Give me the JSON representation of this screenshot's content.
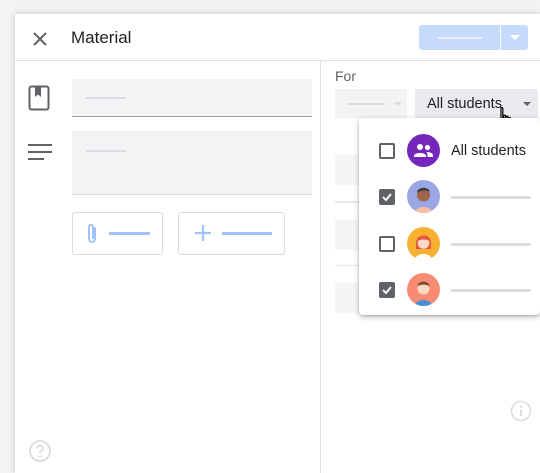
{
  "header": {
    "title": "Material"
  },
  "for_section": {
    "label": "For",
    "students_select": {
      "value": "All students"
    }
  },
  "student_menu": {
    "items": [
      {
        "label": "All students",
        "checked": false,
        "avatar": "group-icon"
      },
      {
        "label": "",
        "checked": true,
        "avatar": "student-avatar"
      },
      {
        "label": "",
        "checked": false,
        "avatar": "student-avatar"
      },
      {
        "label": "",
        "checked": true,
        "avatar": "student-avatar"
      }
    ]
  },
  "colors": {
    "accent_light": "#c6dafc",
    "group_avatar": "#7627bb",
    "placeholder_line": "#a1c2fa",
    "checkbox": "#5f6368"
  }
}
